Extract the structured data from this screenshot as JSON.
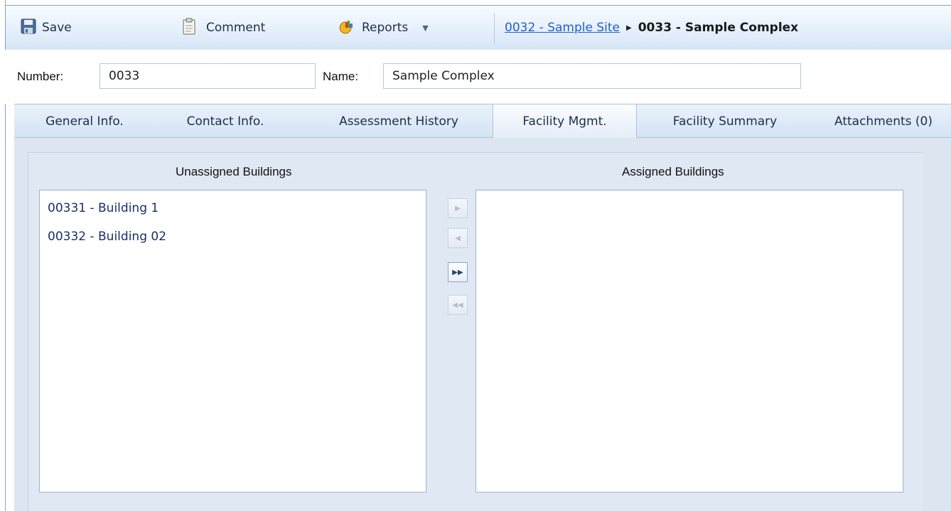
{
  "toolbar": {
    "save": {
      "label": "Save",
      "icon": "save-icon"
    },
    "comment": {
      "label": "Comment",
      "icon": "clipboard-icon"
    },
    "reports": {
      "label": "Reports",
      "icon": "reports-icon"
    }
  },
  "breadcrumb": {
    "parent": "0032 - Sample Site",
    "current": "0033 - Sample Complex"
  },
  "fields": {
    "number_label": "Number:",
    "number_value": "0033",
    "name_label": "Name:",
    "name_value": "Sample Complex"
  },
  "tabs": [
    {
      "label": "General Info."
    },
    {
      "label": "Contact Info."
    },
    {
      "label": "Assessment History"
    },
    {
      "label": "Facility Mgmt.",
      "active": true
    },
    {
      "label": "Facility Summary"
    },
    {
      "label": "Attachments (0)"
    }
  ],
  "facility": {
    "unassigned_title": "Unassigned Buildings",
    "assigned_title": "Assigned Buildings",
    "unassigned": [
      "00331 - Building 1",
      "00332 - Building 02"
    ],
    "assigned": []
  },
  "colors": {
    "toolbar_bg": "#e6eef8",
    "link": "#1f5fcf",
    "list_text": "#1b2f6b",
    "panel_bg": "#dce6f1"
  }
}
